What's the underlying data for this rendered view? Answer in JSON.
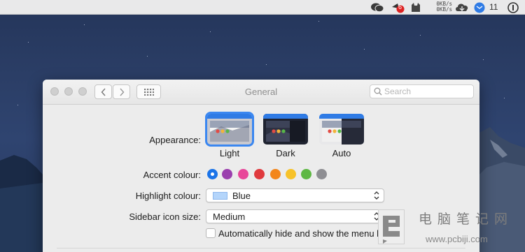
{
  "menubar": {
    "net_up": "0KB/s",
    "net_down": "0KB/s",
    "notification_count": "11",
    "badge_count": "6",
    "icons": [
      "wechat-icon",
      "notification-badge-icon",
      "cat-icon",
      "cloud-icon",
      "mail-icon",
      "info-icon"
    ]
  },
  "window": {
    "title": "General",
    "search_placeholder": "Search"
  },
  "appearance": {
    "label": "Appearance:",
    "options": [
      {
        "label": "Light",
        "selected": true
      },
      {
        "label": "Dark",
        "selected": false
      },
      {
        "label": "Auto",
        "selected": false
      }
    ]
  },
  "accent": {
    "label": "Accent colour:",
    "colors": [
      "#1a73e8",
      "#9b3fae",
      "#e8479a",
      "#e03a3e",
      "#f3861b",
      "#f7c22a",
      "#5eb843",
      "#8e8e93"
    ],
    "selected_index": 0
  },
  "highlight": {
    "label": "Highlight colour:",
    "value": "Blue",
    "swatch_color": "#b4d5fb"
  },
  "sidebar_icon": {
    "label": "Sidebar icon size:",
    "value": "Medium"
  },
  "menubar_autohide": {
    "label": "Automatically hide and show the menu bar",
    "checked": false
  },
  "watermark": {
    "text": "电脑笔记网",
    "url": "www.pcbiji.com"
  }
}
